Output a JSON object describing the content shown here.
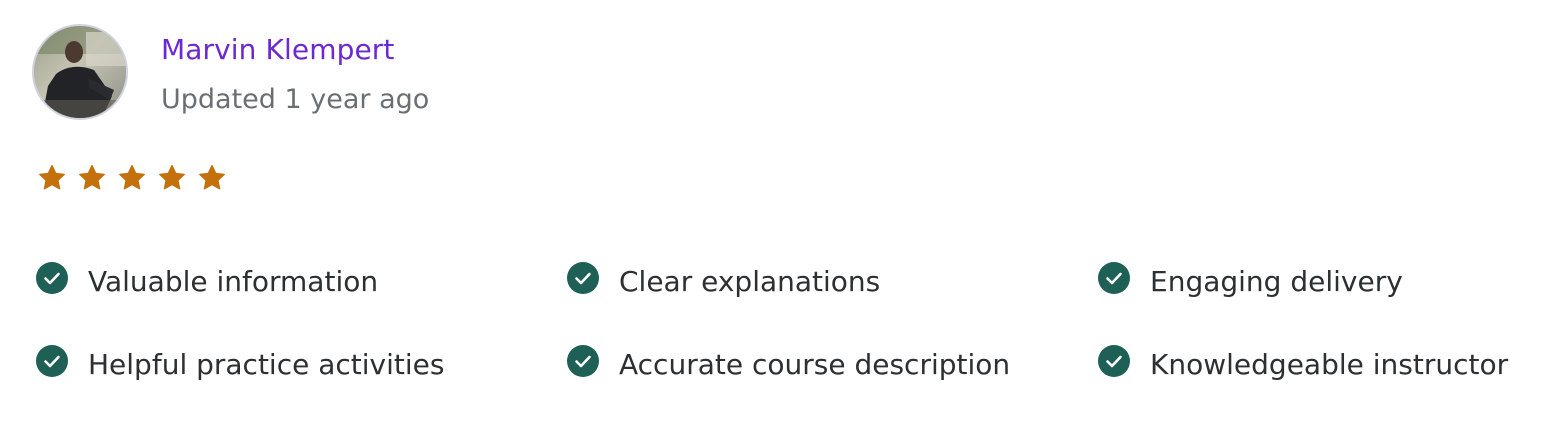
{
  "review": {
    "user_name": "Marvin Klempert",
    "updated": "Updated 1 year ago",
    "avatar_icon": "user-photo",
    "rating": {
      "value": 5,
      "max": 5,
      "star_color": "#c4710d"
    },
    "feedback": [
      {
        "label": "Valuable information",
        "icon": "check-circle-icon"
      },
      {
        "label": "Clear explanations",
        "icon": "check-circle-icon"
      },
      {
        "label": "Engaging delivery",
        "icon": "check-circle-icon"
      },
      {
        "label": "Helpful practice activities",
        "icon": "check-circle-icon"
      },
      {
        "label": "Accurate course description",
        "icon": "check-circle-icon"
      },
      {
        "label": "Knowledgeable instructor",
        "icon": "check-circle-icon"
      }
    ]
  },
  "colors": {
    "accent": "#6d28d2",
    "check": "#1e6055",
    "muted_text": "#6a6f73",
    "body_text": "#2d2f31"
  }
}
